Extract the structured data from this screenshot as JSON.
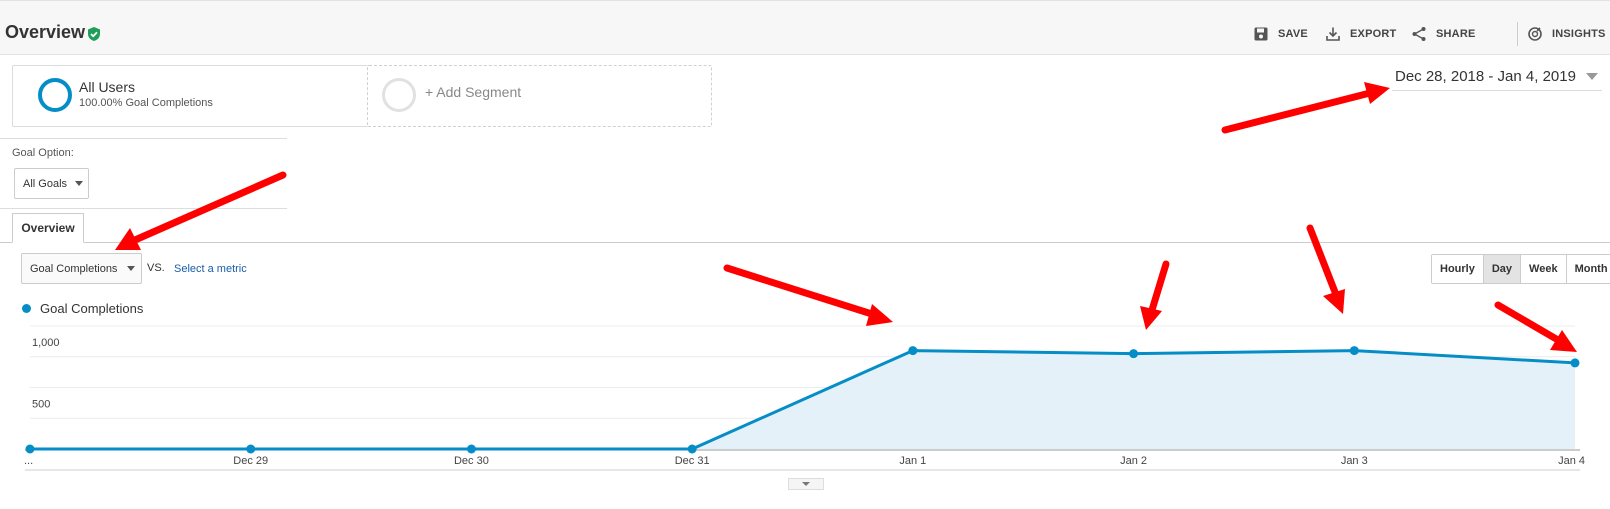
{
  "header": {
    "title": "Overview",
    "actions": [
      {
        "label": "SAVE",
        "icon": "save-icon"
      },
      {
        "label": "EXPORT",
        "icon": "export-icon"
      },
      {
        "label": "SHARE",
        "icon": "share-icon"
      },
      {
        "label": "INSIGHTS",
        "icon": "insights-icon"
      }
    ]
  },
  "segments": {
    "all_users": {
      "title": "All Users",
      "subtitle": "100.00% Goal Completions"
    },
    "add_segment": {
      "label": "+ Add Segment"
    }
  },
  "date_range": "Dec 28, 2018 - Jan 4, 2019",
  "goal_option": {
    "label": "Goal Option:",
    "selected": "All Goals"
  },
  "tabs": [
    {
      "label": "Overview",
      "active": true
    }
  ],
  "metric": {
    "selected": "Goal Completions",
    "vs_label": "VS.",
    "select_metric_link": "Select a metric"
  },
  "granularity": [
    {
      "label": "Hourly",
      "active": false
    },
    {
      "label": "Day",
      "active": true
    },
    {
      "label": "Week",
      "active": false
    },
    {
      "label": "Month",
      "active": false
    }
  ],
  "colors": {
    "series": "#058dc7",
    "fill": "#e5f1f8",
    "annotation": "#ff0000",
    "verified": "#1e9e57"
  },
  "chart_data": {
    "type": "area",
    "categories": [
      "...",
      "Dec 29",
      "Dec 30",
      "Dec 31",
      "Jan 1",
      "Jan 2",
      "Jan 3",
      "Jan 4"
    ],
    "series": [
      {
        "name": "Goal Completions",
        "values": [
          0,
          0,
          0,
          0,
          800,
          775,
          800,
          700
        ]
      }
    ],
    "y_ticks": [
      {
        "value": 500,
        "label": "500"
      },
      {
        "value": 1000,
        "label": "1,000"
      }
    ],
    "ylim": [
      0,
      1000
    ],
    "grid": true,
    "legend": "top-left"
  }
}
